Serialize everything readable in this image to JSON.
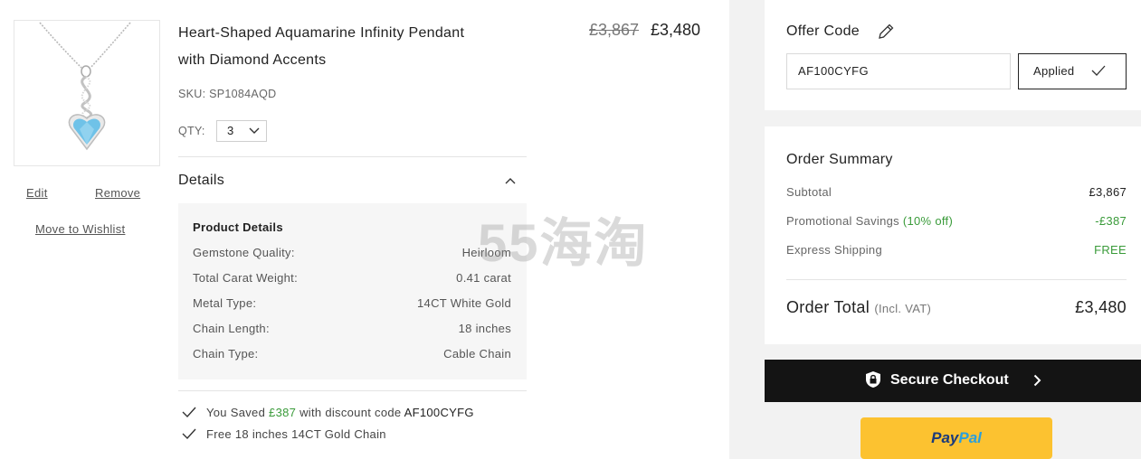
{
  "product": {
    "title_line1": "Heart-Shaped Aquamarine Infinity Pendant",
    "title_line2": "with Diamond Accents",
    "sku": "SKU: SP1084AQD",
    "qty_label": "QTY:",
    "qty_value": "3",
    "price_original": "£3,867",
    "price_current": "£3,480",
    "image_icon": "pendant-image",
    "actions": {
      "edit": "Edit",
      "remove": "Remove",
      "wishlist": "Move to Wishlist"
    }
  },
  "details": {
    "heading": "Details",
    "box_title": "Product Details",
    "rows": [
      {
        "key": "Gemstone Quality:",
        "value": "Heirloom"
      },
      {
        "key": "Total Carat Weight:",
        "value": "0.41 carat"
      },
      {
        "key": "Metal Type:",
        "value": "14CT White Gold"
      },
      {
        "key": "Chain Length:",
        "value": "18 inches"
      },
      {
        "key": "Chain Type:",
        "value": "Cable Chain"
      }
    ]
  },
  "perks": {
    "saved_prefix": "You Saved",
    "saved_amount": "£387",
    "saved_middle": "with discount code",
    "saved_code": "AF100CYFG",
    "free_chain": "Free 18 inches 14CT Gold Chain"
  },
  "watermark": "55海淘",
  "offer": {
    "title": "Offer Code",
    "code_value": "AF100CYFG",
    "applied_label": "Applied"
  },
  "summary": {
    "title": "Order Summary",
    "subtotal_label": "Subtotal",
    "subtotal_value": "£3,867",
    "savings_label": "Promotional Savings",
    "savings_pct": "(10% off)",
    "savings_value": "-£387",
    "shipping_label": "Express Shipping",
    "shipping_value": "FREE",
    "total_label": "Order Total",
    "total_note": "(Incl. VAT)",
    "total_value": "£3,480"
  },
  "checkout": {
    "label": "Secure Checkout"
  },
  "paypal": {
    "part1": "Pay",
    "part2": "Pal"
  },
  "colors": {
    "accent_green": "#3a9b3a",
    "checkout_bg": "#141414",
    "paypal_yellow": "#fcc230"
  }
}
